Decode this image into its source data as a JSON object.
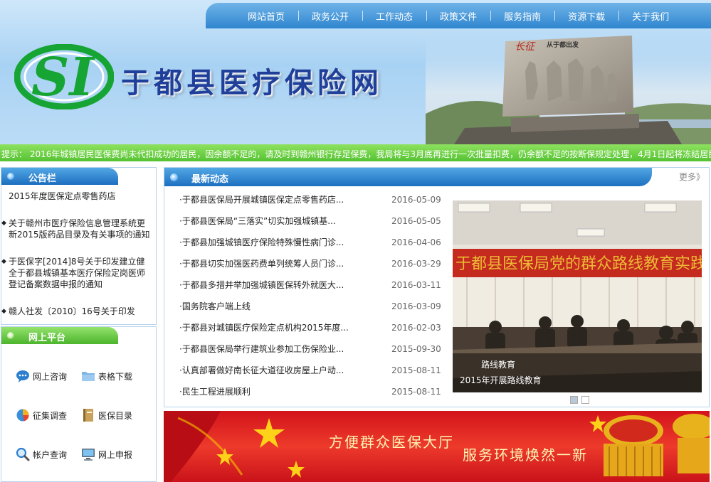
{
  "nav": [
    "网站首页",
    "政务公开",
    "工作动态",
    "政策文件",
    "服务指南",
    "资源下载",
    "关于我们"
  ],
  "site": {
    "title": "于都县医疗保险网",
    "logo_text": "SI",
    "monument_inscription": "从于都出发"
  },
  "marquee": "提示： 2016年城镇居民医保费尚未代扣成功的居民，因余额不足的，请及时到赣州银行存足保费，我局将与3月底再进行一次批量扣费，仍余额不足的按断保规定处理，4月1日起将冻结居民",
  "notice": {
    "title": "公告栏",
    "items": [
      "2015年度医保定点零售药店",
      "关于赣州市医疗保险信息管理系统更新2015版药品目录及有关事项的通知",
      "于医保字[2014]8号关于印发建立健全于都县城镇基本医疗保险定岗医师登记备案数据申报的通知",
      "赣人社发〔2010〕16号关于印发"
    ]
  },
  "platform": {
    "title": "网上平台",
    "items": [
      {
        "label": "网上咨询",
        "icon": "chat-bubble-icon"
      },
      {
        "label": "表格下载",
        "icon": "folder-icon"
      },
      {
        "label": "征集调查",
        "icon": "pie-chart-icon"
      },
      {
        "label": "医保目录",
        "icon": "book-icon"
      },
      {
        "label": "帐户查询",
        "icon": "magnifier-icon"
      },
      {
        "label": "网上申报",
        "icon": "monitor-icon"
      }
    ]
  },
  "news": {
    "title": "最新动态",
    "more": "更多》",
    "items": [
      {
        "title": "·于都县医保局开展城镇医保定点零售药店...",
        "date": "2016-05-09"
      },
      {
        "title": "·于都县医保局“三落实”切实加强城镇基...",
        "date": "2016-05-05"
      },
      {
        "title": "·于都县加强城镇医疗保险特殊慢性病门诊...",
        "date": "2016-04-06"
      },
      {
        "title": "·于都县切实加强医药费单列统筹人员门诊...",
        "date": "2016-03-29"
      },
      {
        "title": "·于都县多措并举加强城镇医保转外就医大...",
        "date": "2016-03-11"
      },
      {
        "title": "·国务院客户端上线",
        "date": "2016-03-09"
      },
      {
        "title": "·于都县对城镇医疗保险定点机构2015年度...",
        "date": "2016-02-03"
      },
      {
        "title": "·于都县医保局举行建筑业参加工伤保险业...",
        "date": "2015-09-30"
      },
      {
        "title": "·认真部署做好南长征大道征收房屋上户动...",
        "date": "2015-08-11"
      },
      {
        "title": "·民生工程进展顺利",
        "date": "2015-08-11"
      }
    ],
    "photo_caption_tag": "路线教育",
    "photo_caption": "2015年开展路线教育",
    "slides": [
      1,
      2
    ]
  },
  "banner": {
    "text1": "方便群众医保大厅",
    "text2": "服务环境焕然一新"
  },
  "colors": {
    "nav_blue": "#2f86cf",
    "title_blue": "#1f3f9a",
    "marquee_green": "#55c233",
    "logo_green": "#16a535",
    "banner_red": "#d3141b"
  }
}
